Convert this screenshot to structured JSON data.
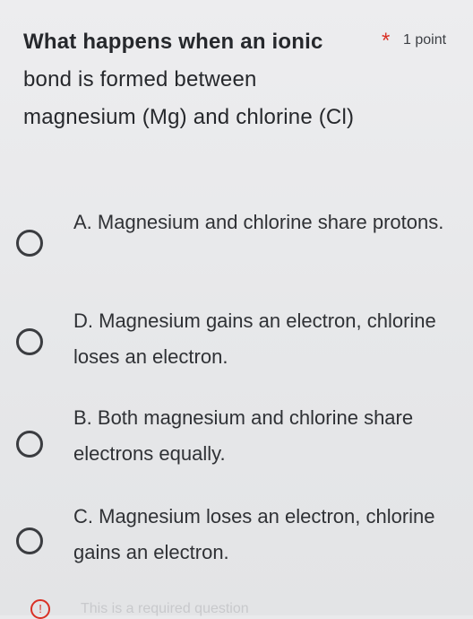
{
  "question": {
    "title_bold": "What happens when an ionic",
    "title_rest": "bond is formed between magnesium (Mg) and chlorine (Cl)",
    "required_marker": "*",
    "points": "1 point"
  },
  "options": [
    {
      "label": "A. Magnesium and chlorine share protons."
    },
    {
      "label": "D. Magnesium gains an electron, chlorine loses an electron."
    },
    {
      "label": "B. Both magnesium and chlorine share electrons equally."
    },
    {
      "label": "C. Magnesium loses an electron, chlorine gains an electron."
    }
  ],
  "required_notice": {
    "icon": "!",
    "text": "This is a required question"
  },
  "colors": {
    "background": "#e9eaec",
    "required": "#d93025",
    "text": "#2b2d31"
  }
}
